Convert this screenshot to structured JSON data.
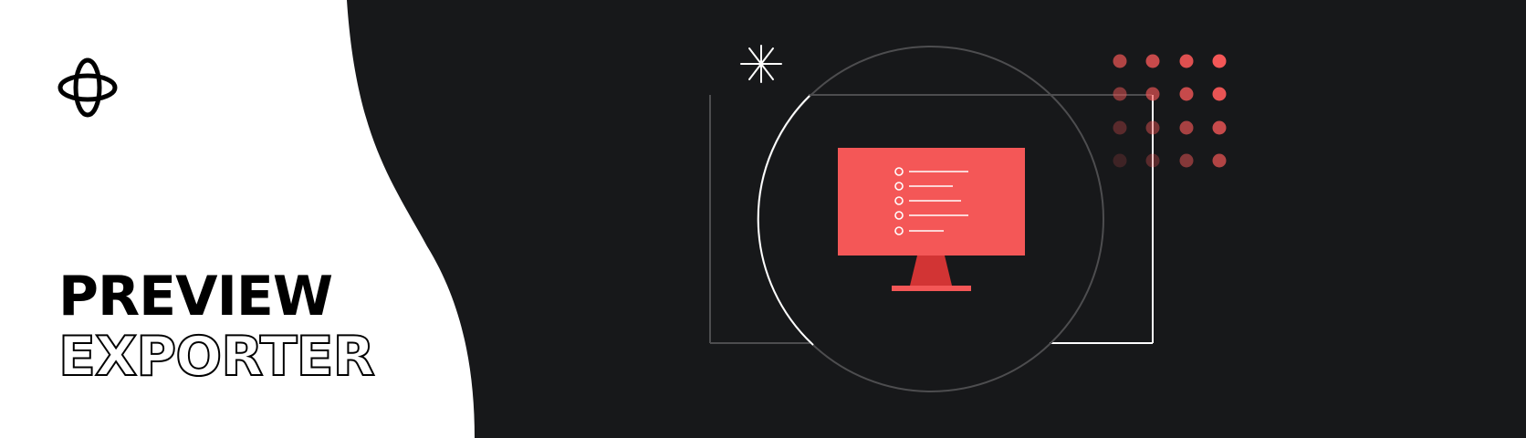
{
  "brand": {
    "icon": "interlocking-rings-logo-icon"
  },
  "title": {
    "line1": "PREVIEW",
    "line2": "EXPORTER"
  },
  "illustration": {
    "icon": "monitor-list-icon",
    "list_items": 5
  },
  "colors": {
    "left_background": "#ffffff",
    "right_background": "#17181a",
    "accent": "#f45757",
    "accent_dark": "#d23434",
    "line_gray": "#4d4d4f",
    "line_white": "#ffffff",
    "text": "#000000"
  }
}
